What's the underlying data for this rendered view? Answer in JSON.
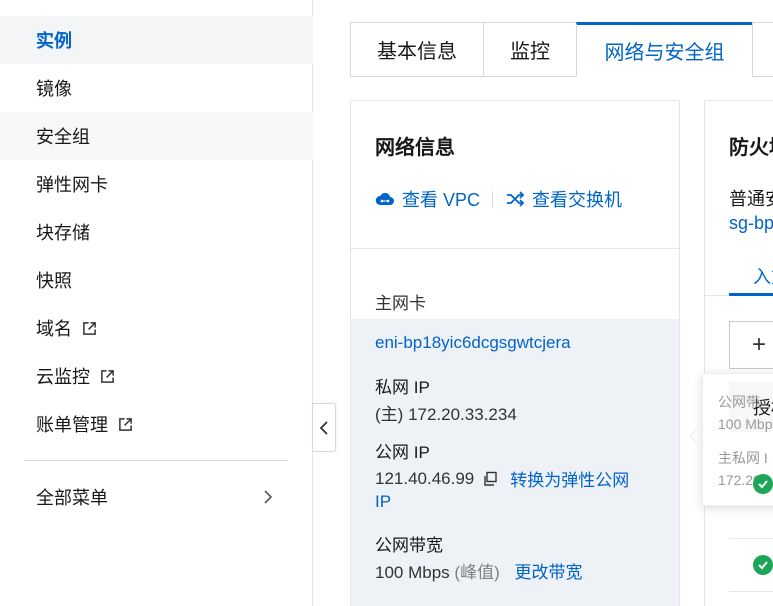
{
  "sidebar": {
    "items": [
      {
        "label": "实例",
        "active": true
      },
      {
        "label": "镜像"
      },
      {
        "label": "安全组"
      },
      {
        "label": "弹性网卡"
      },
      {
        "label": "块存储"
      },
      {
        "label": "快照"
      },
      {
        "label": "域名",
        "external": true
      },
      {
        "label": "云监控",
        "external": true
      },
      {
        "label": "账单管理",
        "external": true
      }
    ],
    "all_menu": "全部菜单"
  },
  "tabs": [
    {
      "label": "基本信息"
    },
    {
      "label": "监控"
    },
    {
      "label": "网络与安全组",
      "active": true
    }
  ],
  "network": {
    "title": "网络信息",
    "view_vpc": "查看 VPC",
    "view_switch": "查看交换机",
    "primary_eni_label": "主网卡",
    "eni_id": "eni-bp18yic6dcgsgwtcjera",
    "private_ip_label": "私网 IP",
    "private_ip_prefix": "(主)",
    "private_ip": "172.20.33.234",
    "public_ip_label": "公网 IP",
    "public_ip": "121.40.46.99",
    "convert_eip": "转换为弹性公网",
    "convert_eip_cont": "IP",
    "bandwidth_label": "公网带宽",
    "bandwidth_value": "100 Mbps",
    "bandwidth_peak": "(峰值)",
    "change_bandwidth": "更改带宽"
  },
  "firewall": {
    "title": "防火墙",
    "sg_text": "普通安",
    "sg_link": "sg-bp",
    "tab_in": "入方",
    "add": "+"
  },
  "popover": {
    "header": "授权",
    "line1": "公网带",
    "line2": "100 Mbp",
    "line3": "主私网 I",
    "line4": "172.20."
  },
  "colors": {
    "accent": "#0064c8",
    "success": "#1ca656"
  }
}
